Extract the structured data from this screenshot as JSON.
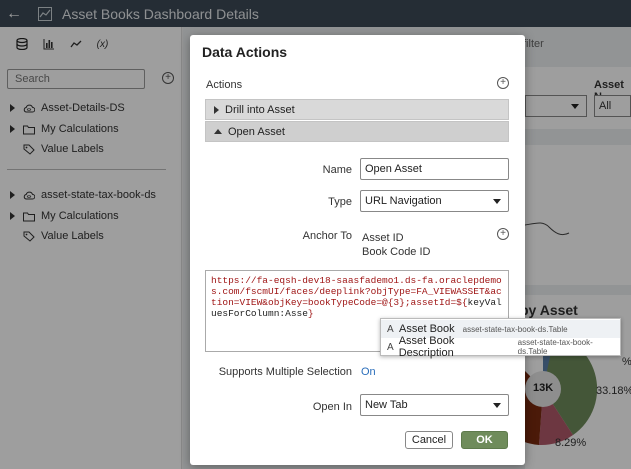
{
  "header": {
    "title": "Asset Books Dashboard Details",
    "back_icon": "back-arrow-icon"
  },
  "sidebar": {
    "tabs": [
      {
        "name": "data-icon",
        "glyph": "≡"
      },
      {
        "name": "visualizations-icon",
        "glyph": "▥"
      },
      {
        "name": "analytics-icon",
        "glyph": "↗"
      },
      {
        "name": "calculation-icon",
        "glyph": "(x)"
      }
    ],
    "search_placeholder": "Search",
    "add_icon": "+",
    "tree1": [
      {
        "label": "Asset-Details-DS",
        "icon": "cloud-db-icon"
      },
      {
        "label": "My Calculations",
        "icon": "folder-icon"
      },
      {
        "label": "Value Labels",
        "icon": "tag-icon"
      }
    ],
    "tree2": [
      {
        "label": "asset-state-tax-book-ds",
        "icon": "cloud-db-icon"
      },
      {
        "label": "My Calculations",
        "icon": "folder-icon"
      },
      {
        "label": "Value Labels",
        "icon": "tag-icon"
      }
    ]
  },
  "background": {
    "filter_text": "filter",
    "asset_label": "Asset N",
    "all_value": "All",
    "chart_title": "by Asset",
    "pie_center": "13K",
    "pct_right": "33.18%",
    "pct_bottom": "8.29%",
    "pct_small": "%"
  },
  "dialog": {
    "title": "Data Actions",
    "actions_label": "Actions",
    "action_items": [
      {
        "label": "Drill into Asset",
        "expanded": false
      },
      {
        "label": "Open Asset",
        "expanded": true
      }
    ],
    "name_label": "Name",
    "name_value": "Open Asset",
    "type_label": "Type",
    "type_value": "URL Navigation",
    "anchor_label": "Anchor To",
    "anchor_values": [
      "Asset ID",
      "Book Code ID"
    ],
    "url_part1": "https://fa-eqsh-dev18-saasfademo1.ds-fa.oraclepdemos.com/fscmUI/faces/deeplink?objType=FA_VIEWASSET&action=VIEW&objKey=bookTypeCode=@{3};assetId=${",
    "url_part2": "keyValuesForColumn:Asse",
    "url_part3": "}",
    "supports_label": "Supports Multiple Selection",
    "supports_value": "On",
    "openin_label": "Open In",
    "openin_value": "New Tab",
    "cancel_label": "Cancel",
    "ok_label": "OK"
  },
  "autocomplete": [
    {
      "type_glyph": "A",
      "label": "Asset Book",
      "source": "asset-state-tax-book-ds.Table"
    },
    {
      "type_glyph": "A",
      "label": "Asset Book Description",
      "source": "asset-state-tax-book-ds.Table"
    }
  ],
  "colors": {
    "topbar": "#3c4a56",
    "ok_button": "#6f8c5b",
    "url_text": "#a01818",
    "link_on": "#2a6ebb"
  }
}
